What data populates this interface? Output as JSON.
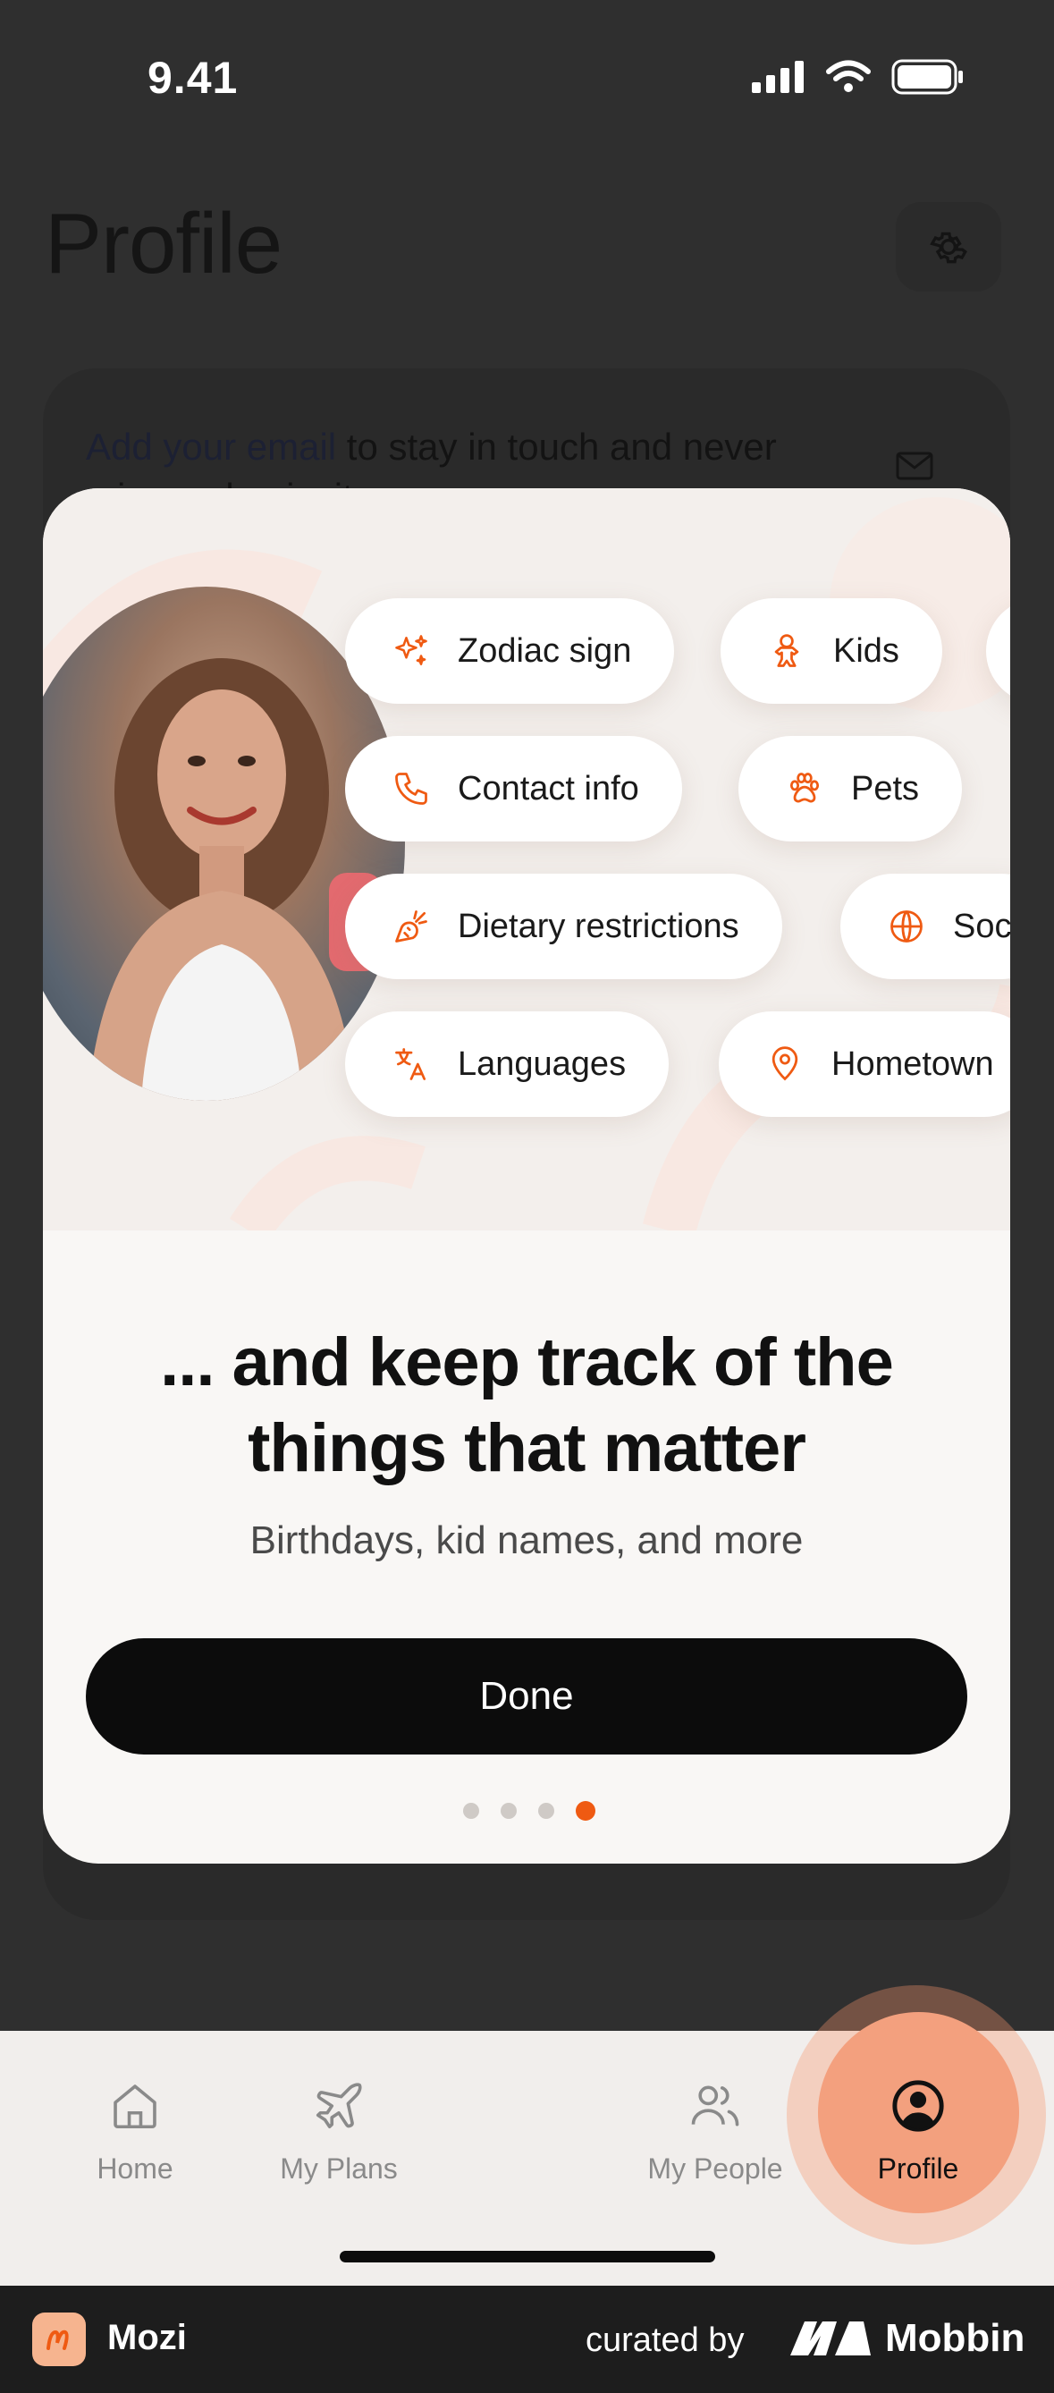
{
  "status_bar": {
    "time": "9.41"
  },
  "background_screen": {
    "title": "Profile",
    "email_prompt_link": "Add your email",
    "email_prompt_rest": " to stay in touch and never miss a plan invite"
  },
  "modal": {
    "chips": [
      {
        "label": "Zodiac sign",
        "icon": "sparkles-icon"
      },
      {
        "label": "Kids",
        "icon": "gingerbread-icon"
      },
      {
        "label": "Contact info",
        "icon": "phone-icon"
      },
      {
        "label": "Pets",
        "icon": "paw-icon"
      },
      {
        "label": "Dietary restrictions",
        "icon": "carrot-icon"
      },
      {
        "label": "Soc",
        "icon": "globe-icon"
      },
      {
        "label": "Languages",
        "icon": "translate-icon"
      },
      {
        "label": "Hometown",
        "icon": "map-pin-icon"
      }
    ],
    "heading_line1": "... and keep track of the",
    "heading_line2": "things that matter",
    "subtitle": "Birthdays, kid names, and more",
    "done_label": "Done",
    "page_count": 4,
    "active_page": 4
  },
  "tab_bar": {
    "tabs": [
      {
        "label": "Home",
        "icon": "home-icon"
      },
      {
        "label": "My Plans",
        "icon": "plane-icon"
      },
      {
        "label": "My People",
        "icon": "people-icon"
      },
      {
        "label": "Profile",
        "icon": "user-circle-icon",
        "active": true
      }
    ]
  },
  "footer": {
    "app_name": "Mozi",
    "curated_by": "curated by",
    "brand": "Mobbin"
  },
  "colors": {
    "accent": "#ef5a12",
    "profile_tab_bg": "#f3a07e",
    "button_bg": "#0c0c0c"
  }
}
